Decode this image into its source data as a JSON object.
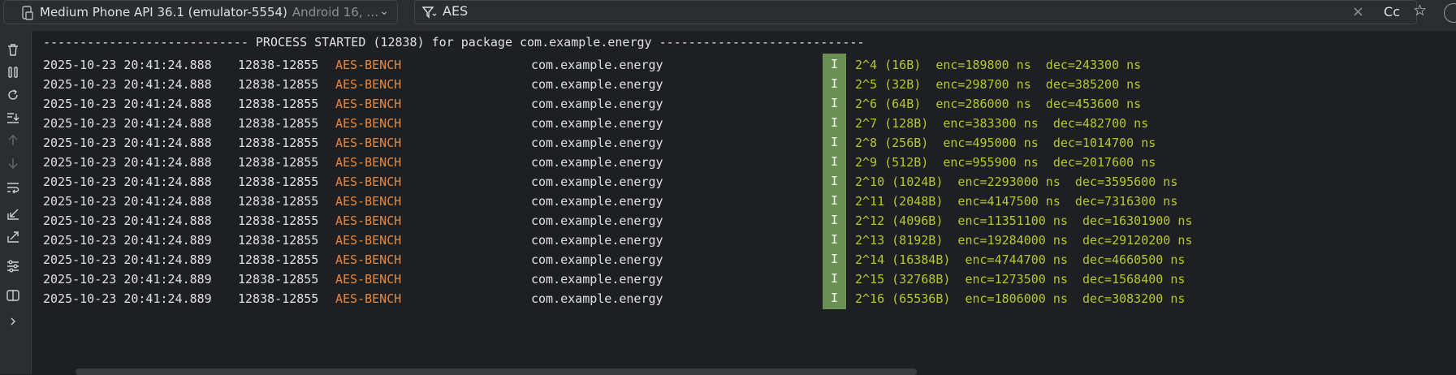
{
  "device": {
    "name": "Medium Phone API 36.1 (emulator-5554)",
    "sub": "Android 16, …"
  },
  "filter": {
    "query": "AES",
    "match_case_label": "Cc"
  },
  "log": {
    "header": "---------------------------- PROCESS STARTED (12838) for package com.example.energy ----------------------------",
    "rows": [
      {
        "date": "2025-10-23 20:41:24.888",
        "pid": "12838-12855",
        "tag": "AES-BENCH",
        "pkg": "com.example.energy",
        "level": "I",
        "msg": "2^4 (16B)  enc=189800 ns  dec=243300 ns"
      },
      {
        "date": "2025-10-23 20:41:24.888",
        "pid": "12838-12855",
        "tag": "AES-BENCH",
        "pkg": "com.example.energy",
        "level": "I",
        "msg": "2^5 (32B)  enc=298700 ns  dec=385200 ns"
      },
      {
        "date": "2025-10-23 20:41:24.888",
        "pid": "12838-12855",
        "tag": "AES-BENCH",
        "pkg": "com.example.energy",
        "level": "I",
        "msg": "2^6 (64B)  enc=286000 ns  dec=453600 ns"
      },
      {
        "date": "2025-10-23 20:41:24.888",
        "pid": "12838-12855",
        "tag": "AES-BENCH",
        "pkg": "com.example.energy",
        "level": "I",
        "msg": "2^7 (128B)  enc=383300 ns  dec=482700 ns"
      },
      {
        "date": "2025-10-23 20:41:24.888",
        "pid": "12838-12855",
        "tag": "AES-BENCH",
        "pkg": "com.example.energy",
        "level": "I",
        "msg": "2^8 (256B)  enc=495000 ns  dec=1014700 ns"
      },
      {
        "date": "2025-10-23 20:41:24.888",
        "pid": "12838-12855",
        "tag": "AES-BENCH",
        "pkg": "com.example.energy",
        "level": "I",
        "msg": "2^9 (512B)  enc=955900 ns  dec=2017600 ns"
      },
      {
        "date": "2025-10-23 20:41:24.888",
        "pid": "12838-12855",
        "tag": "AES-BENCH",
        "pkg": "com.example.energy",
        "level": "I",
        "msg": "2^10 (1024B)  enc=2293000 ns  dec=3595600 ns"
      },
      {
        "date": "2025-10-23 20:41:24.888",
        "pid": "12838-12855",
        "tag": "AES-BENCH",
        "pkg": "com.example.energy",
        "level": "I",
        "msg": "2^11 (2048B)  enc=4147500 ns  dec=7316300 ns"
      },
      {
        "date": "2025-10-23 20:41:24.888",
        "pid": "12838-12855",
        "tag": "AES-BENCH",
        "pkg": "com.example.energy",
        "level": "I",
        "msg": "2^12 (4096B)  enc=11351100 ns  dec=16301900 ns"
      },
      {
        "date": "2025-10-23 20:41:24.889",
        "pid": "12838-12855",
        "tag": "AES-BENCH",
        "pkg": "com.example.energy",
        "level": "I",
        "msg": "2^13 (8192B)  enc=19284000 ns  dec=29120200 ns"
      },
      {
        "date": "2025-10-23 20:41:24.889",
        "pid": "12838-12855",
        "tag": "AES-BENCH",
        "pkg": "com.example.energy",
        "level": "I",
        "msg": "2^14 (16384B)  enc=4744700 ns  dec=4660500 ns"
      },
      {
        "date": "2025-10-23 20:41:24.889",
        "pid": "12838-12855",
        "tag": "AES-BENCH",
        "pkg": "com.example.energy",
        "level": "I",
        "msg": "2^15 (32768B)  enc=1273500 ns  dec=1568400 ns"
      },
      {
        "date": "2025-10-23 20:41:24.889",
        "pid": "12838-12855",
        "tag": "AES-BENCH",
        "pkg": "com.example.energy",
        "level": "I",
        "msg": "2^16 (65536B)  enc=1806000 ns  dec=3083200 ns"
      }
    ]
  },
  "toolbar_icons": [
    "trash-icon",
    "pause-icon",
    "restart-icon",
    "scroll-to-end-icon",
    "up-arrow-icon",
    "down-arrow-icon",
    "soft-wrap-icon",
    "import-icon",
    "export-icon",
    "settings-sliders-icon",
    "split-view-icon",
    "more-chevron-icon"
  ],
  "colors": {
    "tag": "#e6883c",
    "level_info_bg": "#6a9153",
    "message": "#b8c72e",
    "background": "#1e1f22"
  }
}
